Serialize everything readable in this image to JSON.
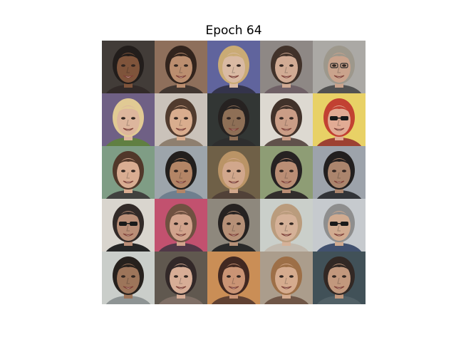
{
  "figure": {
    "title": "Epoch 64"
  },
  "samples": [
    {
      "bg": "#3b3530",
      "skin": "#7a4e34",
      "hair": "#1a1412",
      "shirt": "#2a2220",
      "accessory": "none"
    },
    {
      "bg": "#8a6a55",
      "skin": "#b98a6a",
      "hair": "#2a1c14",
      "shirt": "#3a2e28",
      "accessory": "none"
    },
    {
      "bg": "#5a5e9a",
      "skin": "#d8b8a0",
      "hair": "#c8a870",
      "shirt": "#2c2c44",
      "accessory": "none"
    },
    {
      "bg": "#8a8480",
      "skin": "#d0a890",
      "hair": "#3a2a22",
      "shirt": "#6a5a60",
      "accessory": "none"
    },
    {
      "bg": "#a8a6a2",
      "skin": "#c8a088",
      "hair": "#9a9488",
      "shirt": "#4a4a4a",
      "accessory": "glasses"
    },
    {
      "bg": "#6a5a80",
      "skin": "#dcb49a",
      "hair": "#e0c890",
      "shirt": "#5a7a3a",
      "accessory": "none"
    },
    {
      "bg": "#c8c0b8",
      "skin": "#d8aa8a",
      "hair": "#4a3426",
      "shirt": "#8a7a6a",
      "accessory": "none"
    },
    {
      "bg": "#2a2e2c",
      "skin": "#8a6a50",
      "hair": "#1e1a18",
      "shirt": "#262626",
      "accessory": "none"
    },
    {
      "bg": "#dcd8d0",
      "skin": "#c89a82",
      "hair": "#3a2a22",
      "shirt": "#5a4a44",
      "accessory": "none"
    },
    {
      "bg": "#e8d060",
      "skin": "#e0a890",
      "hair": "#c03a2a",
      "shirt": "#9a3a2a",
      "accessory": "sunglasses"
    },
    {
      "bg": "#7a9a80",
      "skin": "#d8aa8e",
      "hair": "#4a3022",
      "shirt": "#3a3a38",
      "accessory": "none"
    },
    {
      "bg": "#9aa2a8",
      "skin": "#b08060",
      "hair": "#1a1614",
      "shirt": "#6a7a8a",
      "accessory": "none"
    },
    {
      "bg": "#6a5a40",
      "skin": "#d0a488",
      "hair": "#b89060",
      "shirt": "#4a3a30",
      "accessory": "none"
    },
    {
      "bg": "#8a9a70",
      "skin": "#b88a70",
      "hair": "#1e1a1a",
      "shirt": "#2a2624",
      "accessory": "none"
    },
    {
      "bg": "#9aa0a8",
      "skin": "#a88068",
      "hair": "#1a1616",
      "shirt": "#2a2c30",
      "accessory": "none"
    },
    {
      "bg": "#d8d4cc",
      "skin": "#b88a72",
      "hair": "#2a2220",
      "shirt": "#1e1e1e",
      "accessory": "sunglasses"
    },
    {
      "bg": "#c04a6a",
      "skin": "#d0a088",
      "hair": "#6a4a3a",
      "shirt": "#4a3040",
      "accessory": "none"
    },
    {
      "bg": "#8a8478",
      "skin": "#b48c72",
      "hair": "#1e1a18",
      "shirt": "#222222",
      "accessory": "none"
    },
    {
      "bg": "#c8cec8",
      "skin": "#d4ae94",
      "hair": "#b89878",
      "shirt": "#c0b8ac",
      "accessory": "none"
    },
    {
      "bg": "#c4c8cc",
      "skin": "#d0a88c",
      "hair": "#8a8a8a",
      "shirt": "#3a4a6a",
      "accessory": "sunglasses"
    },
    {
      "bg": "#c8ccc8",
      "skin": "#9a7054",
      "hair": "#1e1814",
      "shirt": "#8a9090",
      "accessory": "none"
    },
    {
      "bg": "#5a5248",
      "skin": "#d6aa92",
      "hair": "#2a2020",
      "shirt": "#7a6a60",
      "accessory": "none"
    },
    {
      "bg": "#c88a50",
      "skin": "#c89070",
      "hair": "#3a2018",
      "shirt": "#5a3a2a",
      "accessory": "none"
    },
    {
      "bg": "#a89a88",
      "skin": "#d4a88a",
      "hair": "#9a6a40",
      "shirt": "#6a5040",
      "accessory": "none"
    },
    {
      "bg": "#3a4a52",
      "skin": "#c09478",
      "hair": "#2a201c",
      "shirt": "#4a5a60",
      "accessory": "none"
    }
  ]
}
